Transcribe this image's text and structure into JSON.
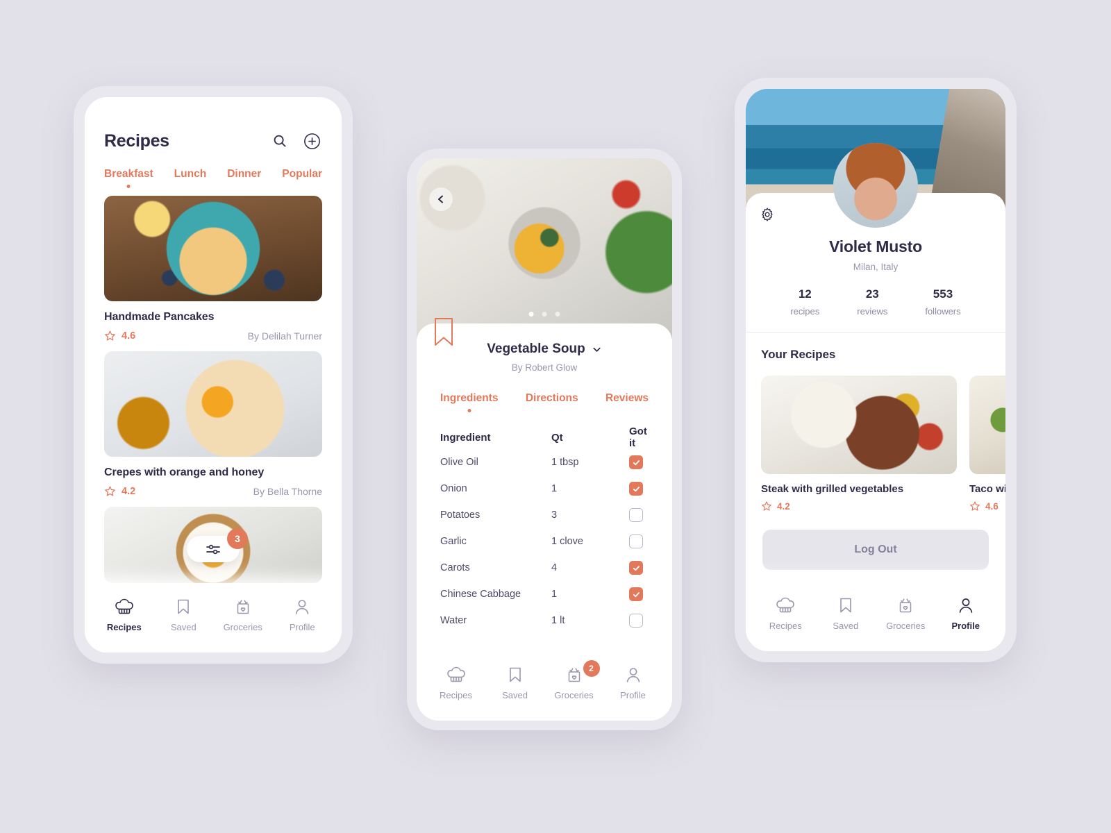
{
  "theme": {
    "accent": "#E2795B",
    "ink": "#2E2B49",
    "ink_soft": "#9A96AE",
    "page_bg": "#E2E0E9",
    "frame_bg": "#EAE8EF"
  },
  "phone_recipes": {
    "header": {
      "title": "Recipes",
      "search_icon": "search-icon",
      "add_icon": "plus-circle-icon"
    },
    "tabs": [
      {
        "label": "Breakfast",
        "active": true
      },
      {
        "label": "Lunch",
        "active": false
      },
      {
        "label": "Dinner",
        "active": false
      },
      {
        "label": "Popular",
        "active": false
      }
    ],
    "recipes": [
      {
        "name": "Handmade Pancakes",
        "rating": "4.6",
        "author": "By Delilah Turner",
        "photo": "pancakes"
      },
      {
        "name": "Crepes with orange and honey",
        "rating": "4.2",
        "author": "By Bella Thorne",
        "photo": "crepes"
      },
      {
        "name": "",
        "rating": "",
        "author": "",
        "photo": "egg-toast"
      }
    ],
    "filter_pill": {
      "icon": "sliders-icon",
      "badge": "3"
    },
    "nav": [
      {
        "label": "Recipes",
        "icon": "chef-hat-icon",
        "active": true,
        "badge": ""
      },
      {
        "label": "Saved",
        "icon": "bookmark-icon",
        "active": false,
        "badge": ""
      },
      {
        "label": "Groceries",
        "icon": "grocery-bag-icon",
        "active": false,
        "badge": ""
      },
      {
        "label": "Profile",
        "icon": "person-icon",
        "active": false,
        "badge": ""
      }
    ]
  },
  "phone_detail": {
    "back_icon": "chevron-left-icon",
    "hero_photo": "vegetable-soup",
    "carousel_dots": 3,
    "carousel_active_index": 0,
    "bookmark_icon": "bookmark-outline-icon",
    "recipe_title": "Vegetable Soup",
    "title_chevron": "chevron-down-icon",
    "recipe_author": "By Robert Glow",
    "tabs": [
      {
        "label": "Ingredients",
        "active": true
      },
      {
        "label": "Directions",
        "active": false
      },
      {
        "label": "Reviews",
        "active": false
      }
    ],
    "table": {
      "headers": [
        "Ingredient",
        "Qt",
        "Got it"
      ],
      "rows": [
        {
          "ingredient": "Olive Oil",
          "qt": "1 tbsp",
          "got_it": true
        },
        {
          "ingredient": "Onion",
          "qt": "1",
          "got_it": true
        },
        {
          "ingredient": "Potatoes",
          "qt": "3",
          "got_it": false
        },
        {
          "ingredient": "Garlic",
          "qt": "1 clove",
          "got_it": false
        },
        {
          "ingredient": "Carots",
          "qt": "4",
          "got_it": true
        },
        {
          "ingredient": "Chinese Cabbage",
          "qt": "1",
          "got_it": true
        },
        {
          "ingredient": "Water",
          "qt": "1 lt",
          "got_it": false
        }
      ]
    },
    "nav": [
      {
        "label": "Recipes",
        "icon": "chef-hat-icon",
        "active": false,
        "badge": ""
      },
      {
        "label": "Saved",
        "icon": "bookmark-icon",
        "active": false,
        "badge": ""
      },
      {
        "label": "Groceries",
        "icon": "grocery-bag-icon",
        "active": false,
        "badge": "2"
      },
      {
        "label": "Profile",
        "icon": "person-icon",
        "active": false,
        "badge": ""
      }
    ]
  },
  "phone_profile": {
    "cover_photo": "beach-cliff",
    "settings_icon": "gear-icon",
    "avatar": "user-avatar-photo",
    "name": "Violet Musto",
    "location": "Milan, Italy",
    "stats": [
      {
        "num": "12",
        "label": "recipes"
      },
      {
        "num": "23",
        "label": "reviews"
      },
      {
        "num": "553",
        "label": "followers"
      }
    ],
    "section_title": "Your Recipes",
    "recipes": [
      {
        "name": "Steak with grilled vegetables",
        "rating": "4.2",
        "photo": "steak"
      },
      {
        "name": "Taco wi",
        "rating": "4.6",
        "photo": "taco"
      }
    ],
    "logout_label": "Log Out",
    "nav": [
      {
        "label": "Recipes",
        "icon": "chef-hat-icon",
        "active": false,
        "badge": ""
      },
      {
        "label": "Saved",
        "icon": "bookmark-icon",
        "active": false,
        "badge": ""
      },
      {
        "label": "Groceries",
        "icon": "grocery-bag-icon",
        "active": false,
        "badge": ""
      },
      {
        "label": "Profile",
        "icon": "person-icon",
        "active": true,
        "badge": ""
      }
    ]
  }
}
